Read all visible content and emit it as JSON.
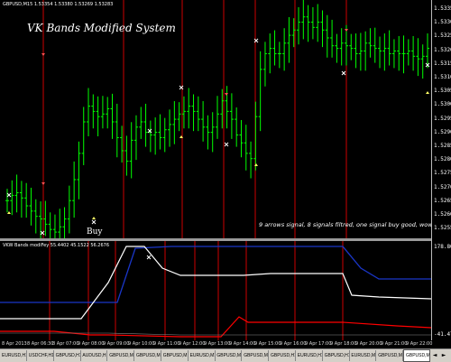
{
  "chart": {
    "symbol_info": "GBPUSD,M15  1.53354 1.53380 1.53269 1.53283",
    "title": "VK Bands Modified System",
    "buy_label": "Buy",
    "note": "9 arrows signal, 8 signals filtred, one signal buy good, wow!",
    "colors": {
      "bull": "#00ff00",
      "signal_line": "#ff0000",
      "background": "#000000"
    }
  },
  "price_scale": [
    "1.5335",
    "1.5330",
    "1.5325",
    "1.5320",
    "1.5315",
    "1.5310",
    "1.5305",
    "1.5300",
    "1.5295",
    "1.5290",
    "1.5285",
    "1.5280",
    "1.5275",
    "1.5270",
    "1.5265",
    "1.5260",
    "1.5255"
  ],
  "indicator": {
    "info": "VKW Bands modiFey 55.4402 45.1522 56.2676",
    "scale_top": "178.8087",
    "scale_bottom": "-41.4794"
  },
  "time_axis": [
    "8 Apr 2013",
    "8 Apr 06:30",
    "8 Apr 07:00",
    "9 Apr 08:00",
    "9 Apr 09:00",
    "9 Apr 10:00",
    "9 Apr 11:00",
    "9 Apr 12:00",
    "9 Apr 13:00",
    "9 Apr 14:00",
    "9 Apr 15:00",
    "9 Apr 16:00",
    "9 Apr 17:00",
    "9 Apr 18:00",
    "9 Apr 20:00",
    "9 Apr 21:00",
    "9 Apr 22:00"
  ],
  "tabs": [
    "EURUSD,H1",
    "USDCHF,H1",
    "GBPUSD,H1",
    "AUDUSD,H1",
    "GBPUSD,M15",
    "GBPUSD,M15",
    "GBPUSD,M15",
    "EURUSD,M15",
    "GBPUSD,M30",
    "GBPUSD,M15",
    "GBPUSD,H1",
    "EURUSD,H1",
    "GBPUSD,H1",
    "EURUSD,M15",
    "GBPUSD,M15",
    "GBPUSD,M15"
  ],
  "active_tab_index": 15,
  "nav": {
    "left": "◄",
    "right": "►"
  },
  "chart_data": {
    "type": "candlestick",
    "series": [
      {
        "name": "GBPUSD,M15",
        "values": [
          1.5262,
          1.5264,
          1.5265,
          1.5263,
          1.526,
          1.5258,
          1.5256,
          1.5255,
          1.5253,
          1.5251,
          1.525,
          1.5252,
          1.5255,
          1.5262,
          1.527,
          1.528,
          1.5292,
          1.5298,
          1.5296,
          1.5294,
          1.5295,
          1.5297,
          1.5292,
          1.5286,
          1.5281,
          1.5277,
          1.5285,
          1.529,
          1.5292,
          1.5288,
          1.5287,
          1.5288,
          1.5286,
          1.5289,
          1.5291,
          1.5293,
          1.5295,
          1.5296,
          1.5298,
          1.5296,
          1.5293,
          1.529,
          1.5288,
          1.529,
          1.5295,
          1.53,
          1.5296,
          1.5293,
          1.5287,
          1.5284,
          1.528,
          1.5278,
          1.5294,
          1.5312,
          1.5318,
          1.532,
          1.5318,
          1.5318,
          1.5322,
          1.5325,
          1.5327,
          1.533,
          1.5332,
          1.533,
          1.5328,
          1.533,
          1.5327,
          1.5324,
          1.5321,
          1.532,
          1.5322,
          1.5321,
          1.532,
          1.5318,
          1.5319,
          1.5322,
          1.5321,
          1.532,
          1.5319,
          1.532,
          1.5318,
          1.5319,
          1.5318,
          1.5318,
          1.5319,
          1.5317,
          1.5316,
          1.5317,
          1.532
        ]
      }
    ]
  }
}
